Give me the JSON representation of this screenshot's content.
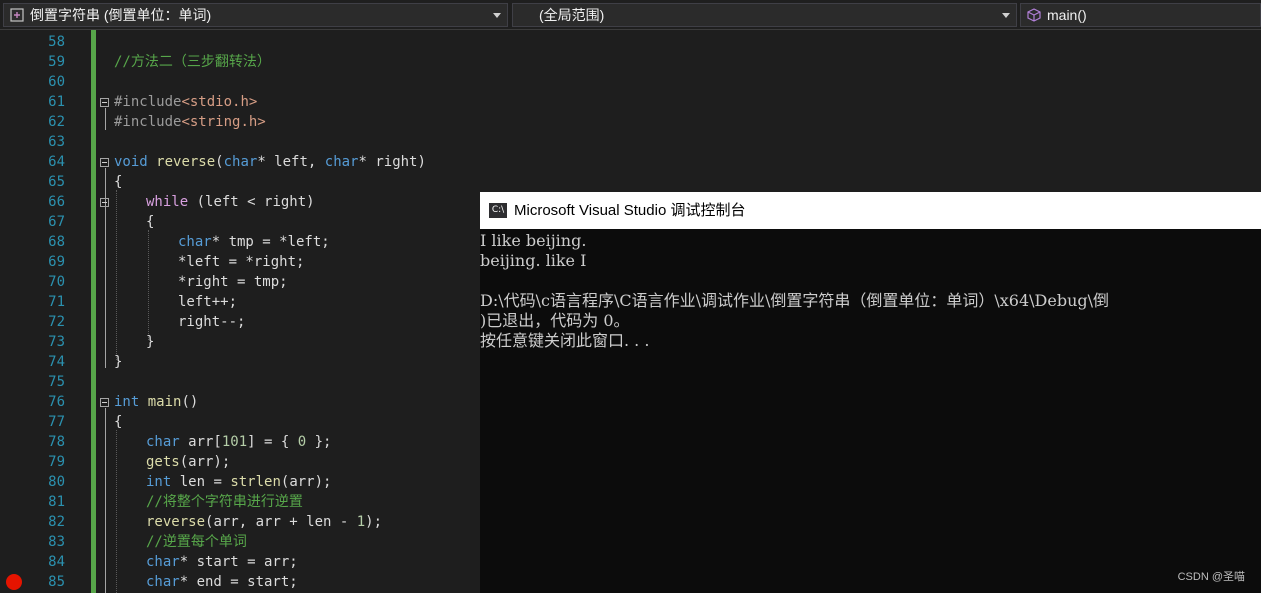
{
  "nav": {
    "project_label": "倒置字符串 (倒置单位：单词)",
    "scope_label": "(全局范围)",
    "member_label": "main()"
  },
  "editor": {
    "lines": [
      {
        "n": "58"
      },
      {
        "n": "59"
      },
      {
        "n": "60"
      },
      {
        "n": "61"
      },
      {
        "n": "62"
      },
      {
        "n": "63"
      },
      {
        "n": "64"
      },
      {
        "n": "65"
      },
      {
        "n": "66"
      },
      {
        "n": "67"
      },
      {
        "n": "68"
      },
      {
        "n": "69"
      },
      {
        "n": "70"
      },
      {
        "n": "71"
      },
      {
        "n": "72"
      },
      {
        "n": "73"
      },
      {
        "n": "74"
      },
      {
        "n": "75"
      },
      {
        "n": "76"
      },
      {
        "n": "77"
      },
      {
        "n": "78"
      },
      {
        "n": "79"
      },
      {
        "n": "80"
      },
      {
        "n": "81"
      },
      {
        "n": "82"
      },
      {
        "n": "83"
      },
      {
        "n": "84"
      },
      {
        "n": "85"
      }
    ],
    "tokens": {
      "l59_comment": "//方法二（三步翻转法）",
      "l61_include": "#include",
      "l61_header": "<stdio.h>",
      "l62_include": "#include",
      "l62_header": "<string.h>",
      "l64_void": "void",
      "l64_fn": "reverse",
      "l64_open": "(",
      "l64_char1": "char",
      "l64_mid": "* left, ",
      "l64_char2": "char",
      "l64_end": "* right)",
      "l65": "{",
      "l66_while": "while",
      "l66_rest": " (left < right)",
      "l67": "{",
      "l68_char": "char",
      "l68_rest": "* tmp = *left;",
      "l69": "*left = *right;",
      "l70": "*right = tmp;",
      "l71": "left++;",
      "l72": "right--;",
      "l73": "}",
      "l74": "}",
      "l76_int": "int",
      "l76_fn": "main",
      "l76_rest": "()",
      "l77": "{",
      "l78_char": "char",
      "l78_a": " arr[",
      "l78_num": "101",
      "l78_b": "] = { ",
      "l78_zero": "0",
      "l78_c": " };",
      "l79_fn": "gets",
      "l79_rest": "(arr);",
      "l80_int": "int",
      "l80_a": " len = ",
      "l80_fn": "strlen",
      "l80_b": "(arr);",
      "l81_comment": "//将整个字符串进行逆置",
      "l82_fn": "reverse",
      "l82_a": "(arr, arr + len - ",
      "l82_num": "1",
      "l82_b": ");",
      "l83_comment": "//逆置每个单词",
      "l84_char": "char",
      "l84_rest": "* start = arr;",
      "l85_char": "char",
      "l85_rest": "* end = start;"
    }
  },
  "console": {
    "title": "Microsoft Visual Studio 调试控制台",
    "icon_label": "C:\\",
    "lines": [
      "I like beijing.",
      "beijing. like I",
      "",
      "D:\\代码\\c语言程序\\C语言作业\\调试作业\\倒置字符串（倒置单位：单词）\\x64\\Debug\\倒",
      ")已退出，代码为 0。",
      "按任意键关闭此窗口. . ."
    ]
  },
  "watermark": "CSDN @圣喵",
  "colors": {
    "editor_bg": "#1e1e1e",
    "line_number": "#2b91af",
    "keyword": "#569cd6",
    "control_keyword": "#d8a0df",
    "function": "#dcdcaa",
    "string": "#d69d85",
    "comment": "#57a64a",
    "console_bg": "#0c0c0c",
    "breakpoint": "#e51400"
  }
}
